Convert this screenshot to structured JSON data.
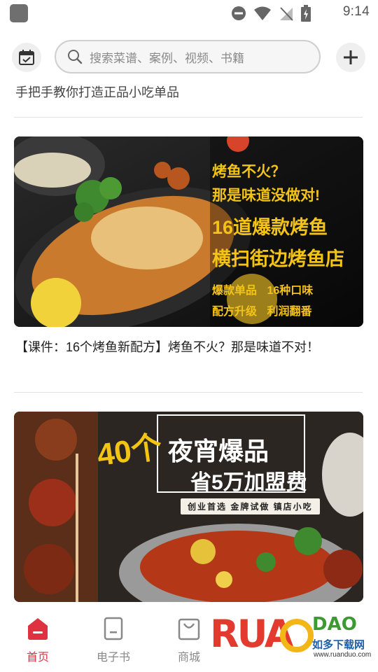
{
  "status_bar": {
    "time": "9:14"
  },
  "header": {
    "search_placeholder": "搜索菜谱、案例、视频、书籍"
  },
  "feed": {
    "cut_off_title": "手把手教你打造正品小吃单品",
    "cards": [
      {
        "banner_lines": [
          "烤鱼不火？",
          "那是味道没做对!",
          "16道爆款烤鱼",
          "横扫街边烤鱼店",
          "爆款单品 16种口味",
          "配方升级 利润翻番"
        ],
        "title": "【课件：16个烤鱼新配方】烤鱼不火？那是味道不对！"
      },
      {
        "banner_lines": [
          "40个",
          "夜宵爆品",
          "省5万加盟费",
          "创业首选 金牌试做 镇店小吃"
        ]
      }
    ]
  },
  "bottom_nav": [
    {
      "label": "首页",
      "active": true
    },
    {
      "label": "电子书",
      "active": false
    },
    {
      "label": "商城",
      "active": false
    }
  ],
  "watermark": {
    "logo": "RUANDUO",
    "subtitle": "如多下载网",
    "url": "www.ruanduo.com"
  },
  "colors": {
    "accent": "#e03140",
    "banner_yellow": "#f3c318"
  },
  "icons": [
    "calendar-icon",
    "search-icon",
    "plus-icon",
    "home-icon",
    "ebook-icon",
    "shop-bag-icon",
    "signal-icon",
    "wifi-icon",
    "battery-icon",
    "dnd-icon"
  ]
}
